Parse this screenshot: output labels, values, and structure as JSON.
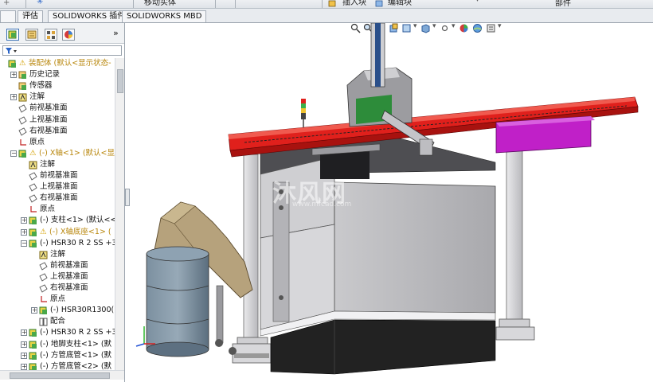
{
  "commandbar": {
    "move_component_label": "移动实体",
    "insert_block_label": "插入块",
    "edit_block_label": "编辑块",
    "document_type_label": "部件"
  },
  "tabs": [
    {
      "label": "评估"
    },
    {
      "label": "SOLIDWORKS 插件"
    },
    {
      "label": "SOLIDWORKS MBD"
    }
  ],
  "feature_tree": {
    "collapse_label": "»",
    "rows": [
      {
        "label": "装配体 (默认<显示状态-",
        "level": 0,
        "exp": "",
        "icon": "assembly-icon",
        "warn": true
      },
      {
        "label": "历史记录",
        "level": 1,
        "exp": "+",
        "icon": "history-icon"
      },
      {
        "label": "传感器",
        "level": 1,
        "exp": "",
        "icon": "sensor-icon"
      },
      {
        "label": "注解",
        "level": 1,
        "exp": "+",
        "icon": "annotation-icon"
      },
      {
        "label": "前视基准面",
        "level": 1,
        "exp": "",
        "icon": "plane-icon"
      },
      {
        "label": "上视基准面",
        "level": 1,
        "exp": "",
        "icon": "plane-icon"
      },
      {
        "label": "右视基准面",
        "level": 1,
        "exp": "",
        "icon": "plane-icon"
      },
      {
        "label": "原点",
        "level": 1,
        "exp": "",
        "icon": "origin-icon"
      },
      {
        "label": "(-) X轴<1> (默认<显",
        "level": 1,
        "exp": "−",
        "icon": "subassembly-icon",
        "warn": true
      },
      {
        "label": "注解",
        "level": 2,
        "exp": "",
        "icon": "annotation-icon"
      },
      {
        "label": "前视基准面",
        "level": 2,
        "exp": "",
        "icon": "plane-icon"
      },
      {
        "label": "上视基准面",
        "level": 2,
        "exp": "",
        "icon": "plane-icon"
      },
      {
        "label": "右视基准面",
        "level": 2,
        "exp": "",
        "icon": "plane-icon"
      },
      {
        "label": "原点",
        "level": 2,
        "exp": "",
        "icon": "origin-icon"
      },
      {
        "label": "(-) 支柱<1> (默认<<",
        "level": 2,
        "exp": "+",
        "icon": "part-icon"
      },
      {
        "label": "(-) X轴底座<1> (",
        "level": 2,
        "exp": "+",
        "icon": "part-icon",
        "warn": true
      },
      {
        "label": "(-) HSR30 R 2 SS +3",
        "level": 2,
        "exp": "−",
        "icon": "subassembly-icon"
      },
      {
        "label": "注解",
        "level": 3,
        "exp": "",
        "icon": "annotation-icon"
      },
      {
        "label": "前视基准面",
        "level": 3,
        "exp": "",
        "icon": "plane-icon"
      },
      {
        "label": "上视基准面",
        "level": 3,
        "exp": "",
        "icon": "plane-icon"
      },
      {
        "label": "右视基准面",
        "level": 3,
        "exp": "",
        "icon": "plane-icon"
      },
      {
        "label": "原点",
        "level": 3,
        "exp": "",
        "icon": "origin-icon"
      },
      {
        "label": "(-) HSR30R1300(",
        "level": 3,
        "exp": "+",
        "icon": "part-icon"
      },
      {
        "label": "配合",
        "level": 3,
        "exp": "",
        "icon": "mates-icon"
      },
      {
        "label": "(-) HSR30 R 2 SS +3",
        "level": 2,
        "exp": "+",
        "icon": "subassembly-icon"
      },
      {
        "label": "(-) 地脚支柱<1> (默",
        "level": 2,
        "exp": "+",
        "icon": "part-icon"
      },
      {
        "label": "(-) 方管底管<1> (默",
        "level": 2,
        "exp": "+",
        "icon": "part-icon"
      },
      {
        "label": "(-) 方管底管<2> (默",
        "level": 2,
        "exp": "+",
        "icon": "part-icon"
      }
    ]
  },
  "viewport": {
    "watermark": "沐风网",
    "watermark_url": "www.mfcad.com",
    "colors": {
      "rail_red": "#e0201c",
      "machine_grey": "#c8c8ca",
      "frame_grey": "#d9d9dc",
      "barrel": "#6f8495",
      "chute": "#b6a27c",
      "magenta_box": "#c020c8",
      "base_dark": "#222222"
    }
  }
}
